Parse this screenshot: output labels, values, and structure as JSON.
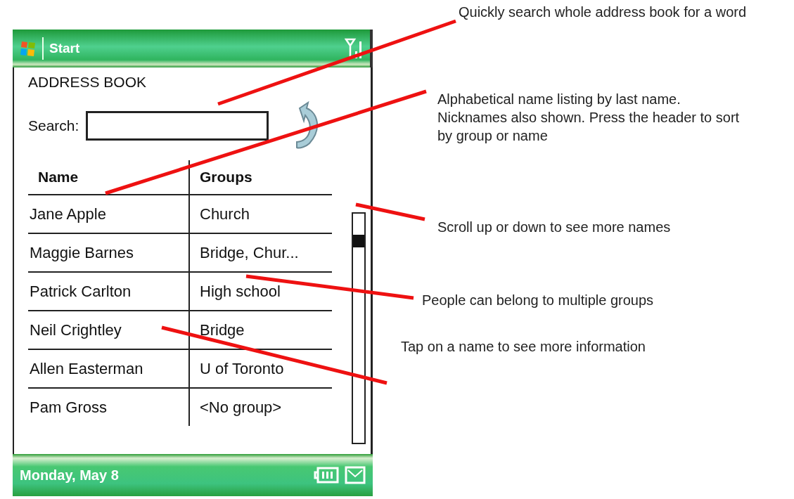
{
  "top_bar": {
    "start_label": "Start"
  },
  "app": {
    "title": "ADDRESS BOOK",
    "search_label": "Search:"
  },
  "table": {
    "columns": [
      "Name",
      "Groups"
    ],
    "rows": [
      {
        "name": "Jane Apple",
        "groups": "Church"
      },
      {
        "name": "Maggie Barnes",
        "groups": "Bridge, Chur..."
      },
      {
        "name": "Patrick Carlton",
        "groups": "High school"
      },
      {
        "name": "Neil Crightley",
        "groups": "Bridge"
      },
      {
        "name": "Allen Easterman",
        "groups": "U of Toronto"
      },
      {
        "name": "Pam Gross",
        "groups": "<No group>"
      }
    ]
  },
  "bottom_bar": {
    "date": "Monday, May 8"
  },
  "annotations": [
    {
      "text": "Quickly search whole address book for a word"
    },
    {
      "text": "Alphabetical name listing by last name. Nicknames also shown. Press the header to sort by group or name"
    },
    {
      "text": "Scroll up or down to see more names"
    },
    {
      "text": "People can belong to multiple groups"
    },
    {
      "text": "Tap on a name to see more information"
    }
  ]
}
